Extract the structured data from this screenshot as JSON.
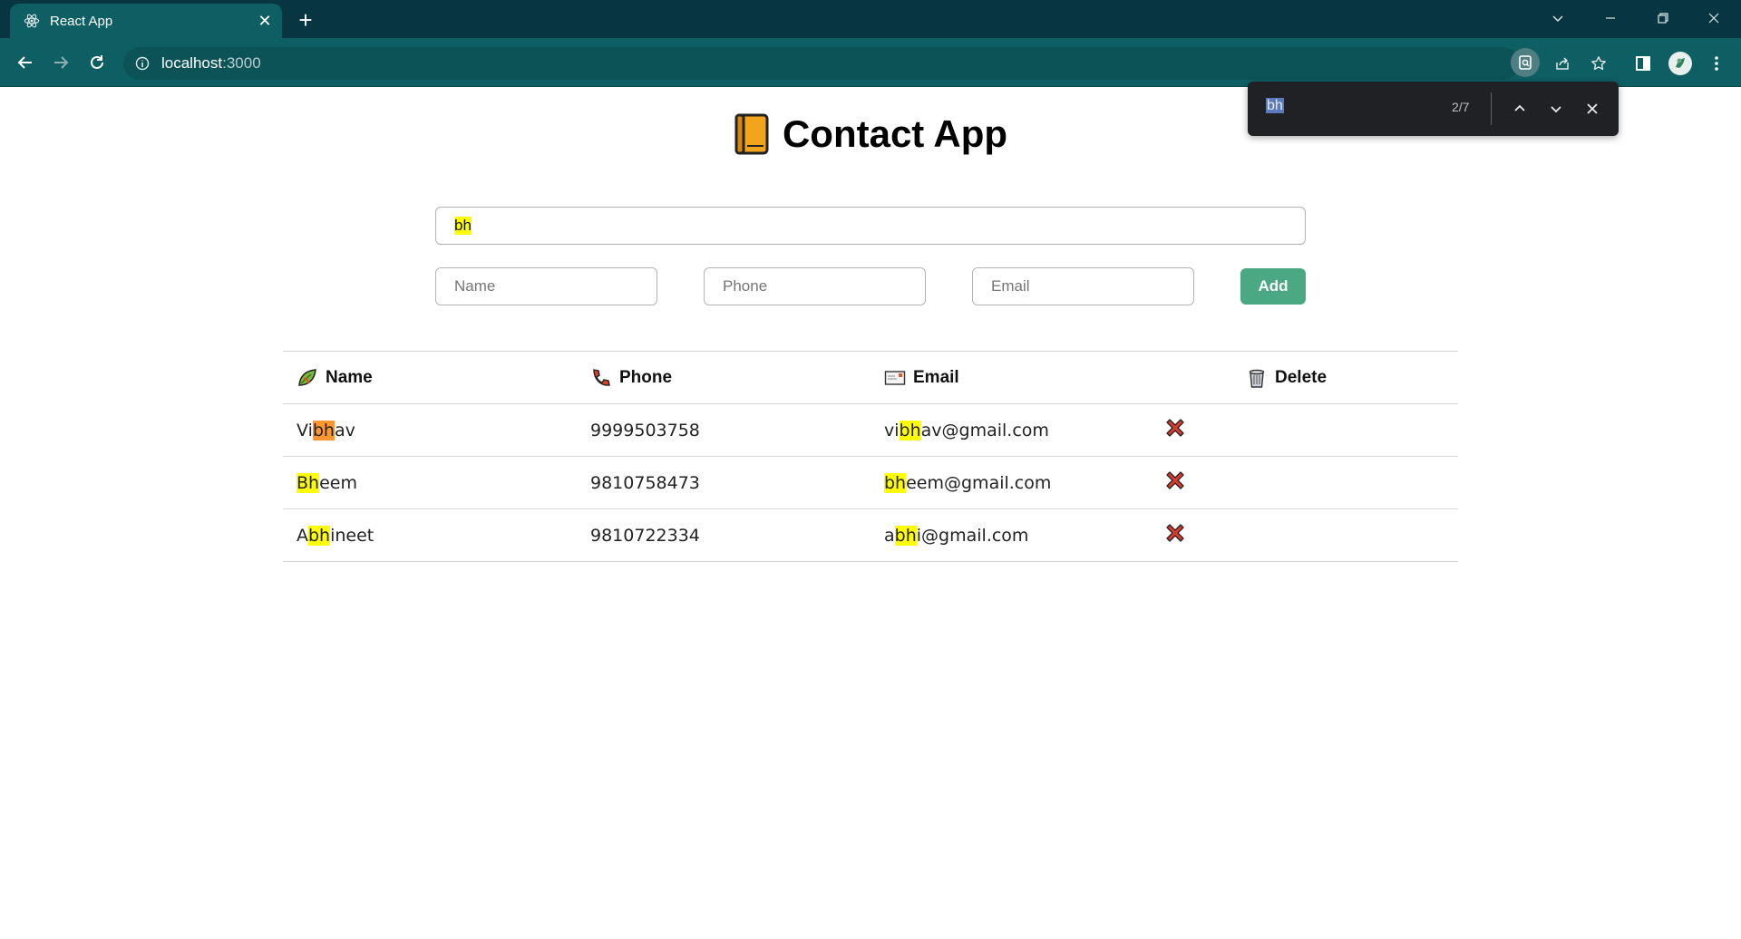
{
  "browser": {
    "tab_title": "React App",
    "url_host": "localhost",
    "url_port": ":3000"
  },
  "findbar": {
    "query": "bh",
    "count": "2/7"
  },
  "app": {
    "title": "Contact App"
  },
  "search": {
    "value": "bh"
  },
  "form": {
    "name_placeholder": "Name",
    "phone_placeholder": "Phone",
    "email_placeholder": "Email",
    "add_label": "Add"
  },
  "table": {
    "headers": {
      "name": "Name",
      "phone": "Phone",
      "email": "Email",
      "delete": "Delete"
    },
    "rows": [
      {
        "name": [
          "Vi",
          "bh",
          "av"
        ],
        "phone": "9999503758",
        "email": [
          "vi",
          "bh",
          "av@gmail.com"
        ]
      },
      {
        "name": [
          "",
          "Bh",
          "eem"
        ],
        "phone": "9810758473",
        "email": [
          "",
          "bh",
          "eem@gmail.com"
        ]
      },
      {
        "name": [
          "A",
          "bh",
          "ineet"
        ],
        "phone": "9810722334",
        "email": [
          "a",
          "bh",
          "i@gmail.com"
        ]
      }
    ]
  },
  "colors": {
    "accent": "#4aa883",
    "chrome": "#0d5f63",
    "highlight": "#ffff00",
    "active_highlight": "#ff9632"
  }
}
